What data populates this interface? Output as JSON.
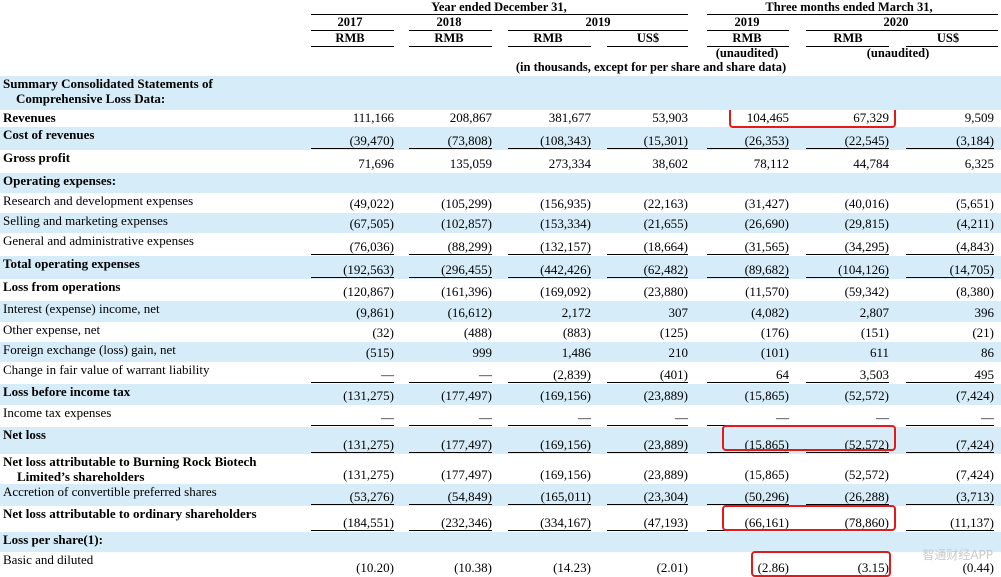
{
  "header": {
    "period1": "Year ended December 31,",
    "period2": "Three months ended March 31,",
    "years": [
      "2017",
      "2018",
      "2019",
      "2019",
      "2020"
    ],
    "currencies": [
      "RMB",
      "RMB",
      "RMB",
      "US$",
      "RMB",
      "RMB",
      "US$"
    ],
    "unaudited": [
      "(unaudited)",
      "(unaudited)"
    ],
    "note": "(in thousands, except for per share and share data)"
  },
  "section_title": [
    "Summary Consolidated Statements of",
    "Comprehensive Loss Data:"
  ],
  "rows": [
    {
      "label": "Revenues",
      "values": [
        "111,166",
        "208,867",
        "381,677",
        "53,903",
        "104,465",
        "67,329",
        "9,509"
      ]
    },
    {
      "label": "Cost of revenues",
      "values": [
        "(39,470)",
        "(73,808)",
        "(108,343)",
        "(15,301)",
        "(26,353)",
        "(22,545)",
        "(3,184)"
      ]
    },
    {
      "label": "Gross profit",
      "values": [
        "71,696",
        "135,059",
        "273,334",
        "38,602",
        "78,112",
        "44,784",
        "6,325"
      ]
    },
    {
      "label": "Operating expenses:",
      "values": []
    },
    {
      "label": "Research and development expenses",
      "values": [
        "(49,022)",
        "(105,299)",
        "(156,935)",
        "(22,163)",
        "(31,427)",
        "(40,016)",
        "(5,651)"
      ]
    },
    {
      "label": "Selling and marketing expenses",
      "values": [
        "(67,505)",
        "(102,857)",
        "(153,334)",
        "(21,655)",
        "(26,690)",
        "(29,815)",
        "(4,211)"
      ]
    },
    {
      "label": "General and administrative expenses",
      "values": [
        "(76,036)",
        "(88,299)",
        "(132,157)",
        "(18,664)",
        "(31,565)",
        "(34,295)",
        "(4,843)"
      ]
    },
    {
      "label": "Total operating expenses",
      "values": [
        "(192,563)",
        "(296,455)",
        "(442,426)",
        "(62,482)",
        "(89,682)",
        "(104,126)",
        "(14,705)"
      ]
    },
    {
      "label": "Loss from operations",
      "values": [
        "(120,867)",
        "(161,396)",
        "(169,092)",
        "(23,880)",
        "(11,570)",
        "(59,342)",
        "(8,380)"
      ]
    },
    {
      "label": "Interest (expense) income, net",
      "values": [
        "(9,861)",
        "(16,612)",
        "2,172",
        "307",
        "(4,082)",
        "2,807",
        "396"
      ]
    },
    {
      "label": "Other expense, net",
      "values": [
        "(32)",
        "(488)",
        "(883)",
        "(125)",
        "(176)",
        "(151)",
        "(21)"
      ]
    },
    {
      "label": "Foreign exchange (loss) gain, net",
      "values": [
        "(515)",
        "999",
        "1,486",
        "210",
        "(101)",
        "611",
        "86"
      ]
    },
    {
      "label": "Change in fair value of warrant liability",
      "values": [
        "—",
        "—",
        "(2,839)",
        "(401)",
        "64",
        "3,503",
        "495"
      ]
    },
    {
      "label": "Loss before income tax",
      "values": [
        "(131,275)",
        "(177,497)",
        "(169,156)",
        "(23,889)",
        "(15,865)",
        "(52,572)",
        "(7,424)"
      ]
    },
    {
      "label": "Income tax expenses",
      "values": [
        "—",
        "—",
        "—",
        "—",
        "—",
        "—",
        "—"
      ]
    },
    {
      "label": "Net loss",
      "values": [
        "(131,275)",
        "(177,497)",
        "(169,156)",
        "(23,889)",
        "(15,865)",
        "(52,572)",
        "(7,424)"
      ]
    },
    {
      "label": [
        "Net loss attributable to Burning Rock Biotech",
        "Limited’s shareholders"
      ],
      "values": [
        "(131,275)",
        "(177,497)",
        "(169,156)",
        "(23,889)",
        "(15,865)",
        "(52,572)",
        "(7,424)"
      ]
    },
    {
      "label": "Accretion of convertible preferred shares",
      "values": [
        "(53,276)",
        "(54,849)",
        "(165,011)",
        "(23,304)",
        "(50,296)",
        "(26,288)",
        "(3,713)"
      ]
    },
    {
      "label": "Net loss attributable to ordinary shareholders",
      "values": [
        "(184,551)",
        "(232,346)",
        "(334,167)",
        "(47,193)",
        "(66,161)",
        "(78,860)",
        "(11,137)"
      ]
    },
    {
      "label": "Loss per share(1):",
      "values": []
    },
    {
      "label": "Basic and diluted",
      "values": [
        "(10.20)",
        "(10.38)",
        "(14.23)",
        "(2.01)",
        "(2.86)",
        "(3.15)",
        "(0.44)"
      ]
    }
  ],
  "watermark": "智通财经APP",
  "highlight_color": "#e21a1a",
  "shade_color": "#d6ecf8"
}
